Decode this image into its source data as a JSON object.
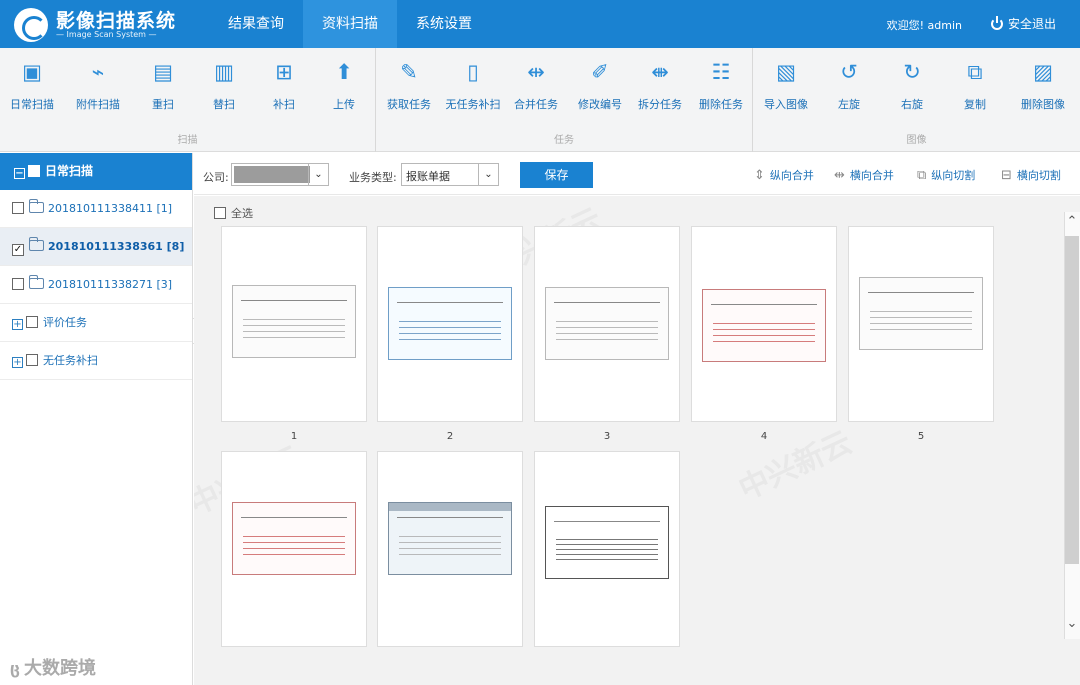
{
  "app": {
    "title": "影像扫描系统",
    "subtitle": "— Image Scan System —"
  },
  "nav": [
    {
      "label": "结果查询"
    },
    {
      "label": "资料扫描",
      "active": true
    },
    {
      "label": "系统设置"
    }
  ],
  "user": {
    "greeting": "欢迎您! admin",
    "logout": "安全退出"
  },
  "toolbar": {
    "groups": [
      {
        "caption": "扫描",
        "tools": [
          {
            "label": "日常扫描",
            "icon": "folder-plus-icon",
            "glyph": "▣"
          },
          {
            "label": "附件扫描",
            "icon": "paperclip-icon",
            "glyph": "⌁"
          },
          {
            "label": "重扫",
            "icon": "document-icon",
            "glyph": "▤"
          },
          {
            "label": "替扫",
            "icon": "copy-document-icon",
            "glyph": "▥"
          },
          {
            "label": "补扫",
            "icon": "add-document-icon",
            "glyph": "⊞"
          },
          {
            "label": "上传",
            "icon": "upload-icon",
            "glyph": "⬆"
          }
        ]
      },
      {
        "caption": "任务",
        "tools": [
          {
            "label": "获取任务",
            "icon": "edit-icon",
            "glyph": "✎"
          },
          {
            "label": "无任务补扫",
            "icon": "blank-document-icon",
            "glyph": "▯"
          },
          {
            "label": "合并任务",
            "icon": "merge-icon",
            "glyph": "⇹"
          },
          {
            "label": "修改编号",
            "icon": "edit-document-icon",
            "glyph": "✐"
          },
          {
            "label": "拆分任务",
            "icon": "split-icon",
            "glyph": "⇼"
          },
          {
            "label": "删除任务",
            "icon": "delete-list-icon",
            "glyph": "☷"
          }
        ]
      },
      {
        "caption": "图像",
        "tools": [
          {
            "label": "导入图像",
            "icon": "import-image-icon",
            "glyph": "▧"
          },
          {
            "label": "左旋",
            "icon": "rotate-left-icon",
            "glyph": "↺"
          },
          {
            "label": "右旋",
            "icon": "rotate-right-icon",
            "glyph": "↻"
          },
          {
            "label": "复制",
            "icon": "duplicate-icon",
            "glyph": "⧉"
          },
          {
            "label": "删除图像",
            "icon": "delete-image-icon",
            "glyph": "▨"
          }
        ]
      }
    ]
  },
  "left_tree": {
    "header": "日常扫描",
    "items": [
      {
        "label": "201810111338411 [1]"
      },
      {
        "label": "201810111338361 [8]",
        "selected": true
      },
      {
        "label": "201810111338271 [3]"
      },
      {
        "label": "评价任务"
      },
      {
        "label": "无任务补扫"
      }
    ]
  },
  "filter": {
    "company_label": "公司:",
    "company_value": "",
    "business_label": "业务类型:",
    "business_value": "报账单据",
    "save_label": "保存",
    "operations": [
      {
        "label": "纵向合并",
        "icon": "vertical-merge-icon",
        "glyph": "⇕"
      },
      {
        "label": "横向合并",
        "icon": "horizontal-merge-icon",
        "glyph": "⇹"
      },
      {
        "label": "纵向切割",
        "icon": "vertical-cut-icon",
        "glyph": "⧉"
      },
      {
        "label": "横向切割",
        "icon": "horizontal-cut-icon",
        "glyph": "⊟"
      }
    ]
  },
  "gallery": {
    "select_all": "全选",
    "thumbnails": [
      {
        "number": "1",
        "type": "invoice"
      },
      {
        "number": "2",
        "type": "blue-invoice"
      },
      {
        "number": "3",
        "type": "receipt"
      },
      {
        "number": "4",
        "type": "red-invoice"
      },
      {
        "number": "5",
        "type": "invoice"
      },
      {
        "number": "",
        "type": "red-invoice"
      },
      {
        "number": "",
        "type": "screen"
      },
      {
        "number": "",
        "type": "table"
      }
    ],
    "watermark": "中兴新云"
  },
  "brand": "大数跨境"
}
